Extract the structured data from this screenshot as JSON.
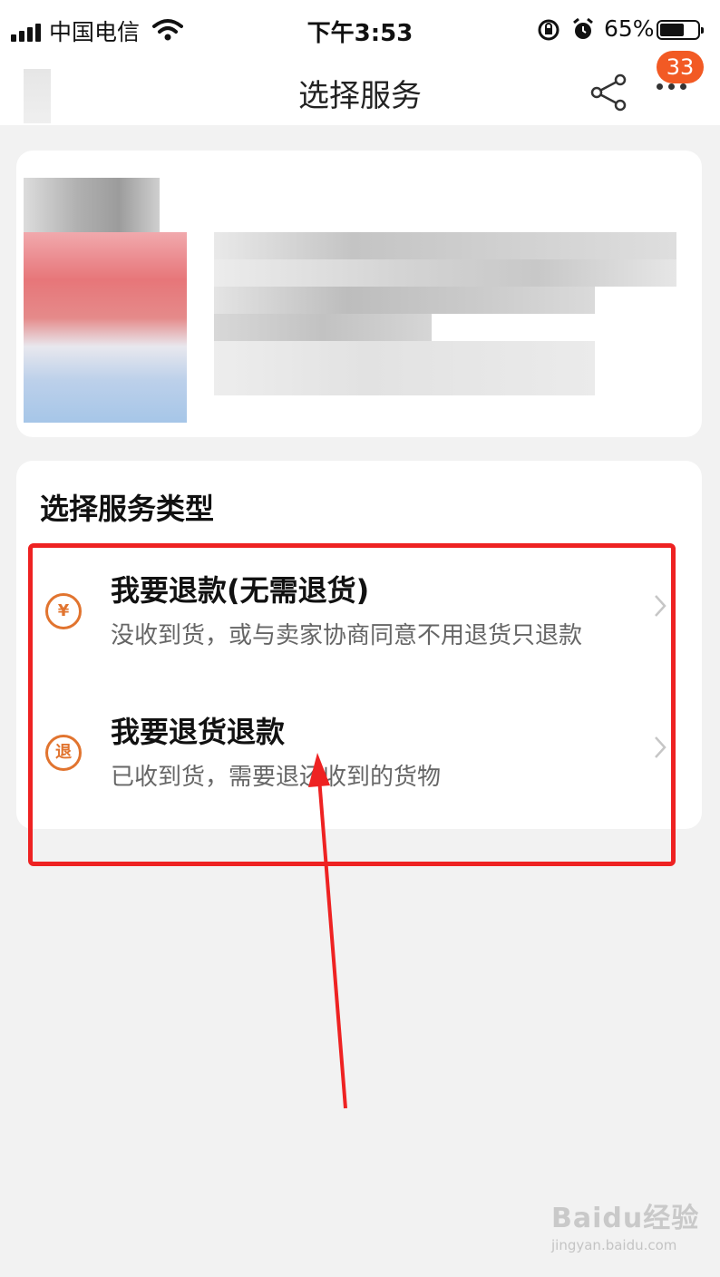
{
  "status_bar": {
    "carrier": "中国电信",
    "time": "下午3:53",
    "battery": "65%",
    "battery_level": 0.65,
    "icons": [
      "signal-icon",
      "wifi-icon",
      "rotation-lock-icon",
      "alarm-icon",
      "battery-icon"
    ]
  },
  "nav": {
    "title": "选择服务",
    "badge_count": "33",
    "icons": [
      "back-icon",
      "share-icon",
      "more-icon"
    ]
  },
  "service": {
    "section_title": "选择服务类型",
    "options": [
      {
        "title": "我要退款(无需退货)",
        "desc": "没收到货，或与卖家协商同意不用退货只退款",
        "icon": "yen-refund-icon",
        "icon_text": "¥"
      },
      {
        "title": "我要退货退款",
        "desc": "已收到货，需要退还收到的货物",
        "icon": "return-icon",
        "icon_text": "退"
      }
    ]
  },
  "colors": {
    "accent": "#e1742f",
    "badge": "#f25a24",
    "annotation": "#ee2222",
    "background": "#f2f2f2"
  },
  "watermark": {
    "logo": "Baidu经验",
    "url": "jingyan.baidu.com"
  }
}
